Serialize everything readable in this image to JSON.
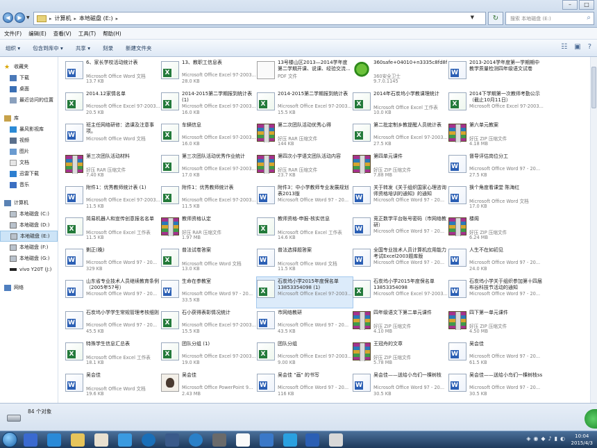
{
  "address": {
    "crumbs": [
      "计算机",
      "本地磁盘 (E:)"
    ],
    "search_placeholder": "搜索 本地磁盘 (E:)"
  },
  "menu": [
    "文件(F)",
    "编辑(E)",
    "查看(V)",
    "工具(T)",
    "帮助(H)"
  ],
  "toolbar": [
    "组织 ▾",
    "包含到库中 ▾",
    "共享 ▾",
    "刻录",
    "新建文件夹"
  ],
  "sidebar": {
    "favorites": {
      "label": "收藏夹",
      "items": [
        "下载",
        "桌面",
        "最近访问的位置"
      ]
    },
    "libraries": {
      "label": "库",
      "items": [
        "暴风影视库",
        "视频",
        "图片",
        "文档",
        "迅雷下载",
        "音乐"
      ]
    },
    "computer": {
      "label": "计算机",
      "items": [
        "本地磁盘 (C:)",
        "本地磁盘 (D:)",
        "本地磁盘 (E:)",
        "本地磁盘 (F:)",
        "本地磁盘 (G:)",
        "vivo Y20T (J:)"
      ]
    },
    "network": {
      "label": "网络"
    }
  },
  "files": [
    {
      "name": "6、家长学校活动统计表",
      "type": "Microsoft Office Word 文档",
      "size": "13.7 KB",
      "icon": "word"
    },
    {
      "name": "13、教职工信息表",
      "type": "Microsoft Office Excel 97-2003...",
      "size": "28.0 KB",
      "icon": "excel"
    },
    {
      "name": "13号楼山区2013—2014学年度第二学期开课、说课、经验交流...",
      "type": "PDF 文件",
      "size": "",
      "icon": "pdf"
    },
    {
      "name": "360safe+04010+n3335c8fd8f",
      "type": "360安全卫士",
      "size": "9.7.0.1145",
      "icon": "360"
    },
    {
      "name": "2013-2014学年度第一学期期中教学质量检测四年级语文试卷",
      "type": "",
      "size": "",
      "icon": "word"
    },
    {
      "name": "2014.12家情名单",
      "type": "Microsoft Office Excel 97-2003...",
      "size": "20.5 KB",
      "icon": "excel"
    },
    {
      "name": "2014-2015第二学期报到统计表 (1)",
      "type": "Microsoft Office Excel 97-2003...",
      "size": "16.0 KB",
      "icon": "excel"
    },
    {
      "name": "2014-2015第二学期报到统计表",
      "type": "Microsoft Office Excel 97-2003...",
      "size": "15.5 KB",
      "icon": "excel"
    },
    {
      "name": "2014年石炭坞小学教课理统计",
      "type": "Microsoft Office Excel 工作表",
      "size": "10.0 KB",
      "icon": "excel"
    },
    {
      "name": "2014下学期第一次教师考勤公示（截止10月11日）",
      "type": "Microsoft Office Excel 97-2003...",
      "size": "",
      "icon": "excel"
    },
    {
      "name": "班主任网络研修：选课及注意事项。",
      "type": "Microsoft Office Word 文档",
      "size": "",
      "icon": "word"
    },
    {
      "name": "车辆信息",
      "type": "Microsoft Office Excel 97-2003...",
      "size": "16.0 KB",
      "icon": "excel"
    },
    {
      "name": "第二次团队活动优秀心得",
      "type": "好压 RAR 压缩文件",
      "size": "144 KB",
      "icon": "rar"
    },
    {
      "name": "第二批定制乡教提醒人员统计表",
      "type": "Microsoft Office Excel 97-2003...",
      "size": "27.5 KB",
      "icon": "excel"
    },
    {
      "name": "第六单元教案",
      "type": "好压 ZIP 压缩文件",
      "size": "4.18 MB",
      "icon": "rar"
    },
    {
      "name": "第三次团队活动材料",
      "type": "好压 RAR 压缩文件",
      "size": "7.40 KB",
      "icon": "rar"
    },
    {
      "name": "第三次团队活动优秀作业统计",
      "type": "Microsoft Office Excel 97-2003...",
      "size": "17.0 KB",
      "icon": "excel"
    },
    {
      "name": "第四次小学语文团队活动内容",
      "type": "好压 RAR 压缩文件",
      "size": "23.7 KB",
      "icon": "rar"
    },
    {
      "name": "第四单元课件",
      "type": "好压 ZIP 压缩文件",
      "size": "7.88 MB",
      "icon": "rar"
    },
    {
      "name": "督导评估岗位分工",
      "type": "Microsoft Office Word 97 - 20...",
      "size": "27.5 KB",
      "icon": "word"
    },
    {
      "name": "附件1：优秀教师统计表 (1)",
      "type": "Microsoft Office Excel 97-2003...",
      "size": "11.5 KB",
      "icon": "word"
    },
    {
      "name": "附件1：优秀教师统计表",
      "type": "Microsoft Office Excel 97-2003...",
      "size": "11.5 KB",
      "icon": "excel"
    },
    {
      "name": "附件3：中小学教师专业发展规划表2013版",
      "type": "Microsoft Office Word 97 - 20...",
      "size": "",
      "icon": "word"
    },
    {
      "name": "关于转发《关于组织国家心理咨询师资格培训的通知》的通知",
      "type": "Microsoft Office Word 97 - 20...",
      "size": "",
      "icon": "word"
    },
    {
      "name": "换个角度看课堂 陈海红",
      "type": "Microsoft Office Word 文档",
      "size": "17.0 KB",
      "icon": "word"
    },
    {
      "name": "简易机器人和宣传创意报名名单",
      "type": "Microsoft Office Excel 工作表",
      "size": "11.5 KB",
      "icon": "excel"
    },
    {
      "name": "教师资格认定",
      "type": "好压 RAR 压缩文件",
      "size": "1.97 MB",
      "icon": "rar"
    },
    {
      "name": "教师资格-申报-核实信息",
      "type": "Microsoft Office Excel 工作表",
      "size": "14.6 KB",
      "icon": "excel"
    },
    {
      "name": "竞正数学平台账号密码（市网络教研）",
      "type": "Microsoft Office Word 97 - 20...",
      "size": "",
      "icon": "word"
    },
    {
      "name": "楼阁",
      "type": "好压 ZIP 压缩文件",
      "size": "6.24 MB",
      "icon": "rar"
    },
    {
      "name": "剿正(晚)",
      "type": "Microsoft Office Word 97 - 20...",
      "size": "329 KB",
      "icon": "word"
    },
    {
      "name": "普法试卷答案",
      "type": "Microsoft Office Word 文档",
      "size": "13.0 KB",
      "icon": "excel"
    },
    {
      "name": "普法选择题答案",
      "type": "Microsoft Office Word 文档",
      "size": "11.5 KB",
      "icon": "word"
    },
    {
      "name": "全国专业技术人员计算机应用能力考试Excel2003题库版",
      "type": "Microsoft Office Word 97 - 20...",
      "size": "",
      "icon": "word"
    },
    {
      "name": "人生不在如初见",
      "type": "Microsoft Office Word 97 - 20...",
      "size": "24.0 KB",
      "icon": "word"
    },
    {
      "name": "山东省专业技术人员继续教育条例（2005年57号）",
      "type": "Microsoft Office Word 97 - 20...",
      "size": "",
      "icon": "word"
    },
    {
      "name": "生命在参教室",
      "type": "Microsoft Office Word 97 - 20...",
      "size": "33.5 KB",
      "icon": "word"
    },
    {
      "name": "石炭坞小学2015年度保名单13853354098 (1)",
      "type": "Microsoft Office Excel 97-2003...",
      "size": "",
      "icon": "excel",
      "selected": true
    },
    {
      "name": "石炭坞小学2015年度保名单13853354098",
      "type": "Microsoft Office Excel 97-2003...",
      "size": "",
      "icon": "excel"
    },
    {
      "name": "石炭坞小学关于组织参加第十四届布谷科技节活动的通知",
      "type": "Microsoft Office Word 97 - 20...",
      "size": "",
      "icon": "word"
    },
    {
      "name": "石炭坞小学学生常规管理考核细则",
      "type": "Microsoft Office Word 97 - 20...",
      "size": "45.5 KB",
      "icon": "word"
    },
    {
      "name": "石小获得表彰情况统计",
      "type": "Microsoft Office Excel 97-2003...",
      "size": "15.5 KB",
      "icon": "excel"
    },
    {
      "name": "市网络教研",
      "type": "Microsoft Office Word 97 - 20...",
      "size": "43.5 KB",
      "icon": "word"
    },
    {
      "name": "四年级语文下第二单元课件",
      "type": "好压 ZIP 压缩文件",
      "size": "4.10 MB",
      "icon": "rar"
    },
    {
      "name": "四下第一单元课件",
      "type": "好压 ZIP 压缩文件",
      "size": "4.50 MB",
      "icon": "rar"
    },
    {
      "name": "特殊学生信息汇总表",
      "type": "Microsoft Office Excel 工作表",
      "size": "18.1 KB",
      "icon": "excel"
    },
    {
      "name": "团队分组 (1)",
      "type": "Microsoft Office Excel 97-2003...",
      "size": "19.0 KB",
      "icon": "excel"
    },
    {
      "name": "团队分组",
      "type": "Microsoft Office Excel 97-2003...",
      "size": "9.00 KB",
      "icon": "excel"
    },
    {
      "name": "王冠舟的文章",
      "type": "好压 ZIP 压缩文件",
      "size": "5.78 MB",
      "icon": "rar"
    },
    {
      "name": "吴会佳",
      "type": "Microsoft Office Word 97 - 20...",
      "size": "61.5 KB",
      "icon": "word"
    },
    {
      "name": "吴会佳",
      "type": "Microsoft Office Word 文档",
      "size": "19.6 KB",
      "icon": "word"
    },
    {
      "name": "吴会佳",
      "type": "Microsoft Office PowerPoint 9...",
      "size": "2.43 MB",
      "icon": "ppt"
    },
    {
      "name": "吴会佳 \"画\" 的书写",
      "type": "Microsoft Office Word 97 - 20...",
      "size": "116 KB",
      "icon": "word"
    },
    {
      "name": "吴会佳——送给小鸟们一棵树枝",
      "type": "Microsoft Office Word 97 - 20...",
      "size": "30.5 KB",
      "icon": "word"
    },
    {
      "name": "吴会佳——送给小鸟们一棵树枝ss",
      "type": "Microsoft Office Word 97 - 20...",
      "size": "30.5 KB",
      "icon": "word"
    }
  ],
  "status": {
    "count": "84 个对象"
  },
  "clock": {
    "time": "10:04",
    "date": "2015/4/3"
  }
}
